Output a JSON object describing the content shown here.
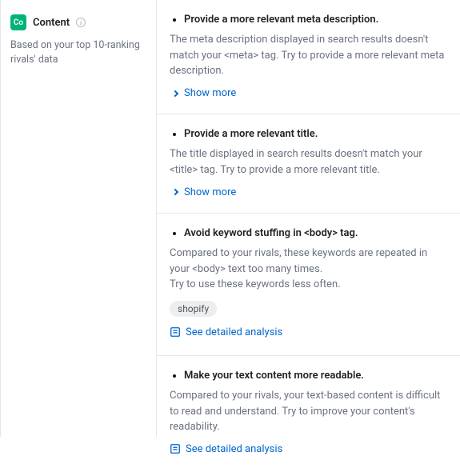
{
  "sidebar": {
    "badge": "Co",
    "title": "Content",
    "subtitle": "Based on your top 10-ranking rivals' data"
  },
  "labels": {
    "show_more": "Show more",
    "detailed_analysis": "See detailed analysis"
  },
  "items": [
    {
      "title": "Provide a more relevant meta description.",
      "desc": "The meta description displayed in search results doesn't match your <meta> tag. Try to provide a more relevant meta description.",
      "action": "show_more"
    },
    {
      "title": "Provide a more relevant title.",
      "desc": "The title displayed in search results doesn't match your <title> tag. Try to provide a more relevant title.",
      "action": "show_more"
    },
    {
      "title": "Avoid keyword stuffing in <body> tag.",
      "desc": "Compared to your rivals, these keywords are repeated in your <body> text too many times.\nTry to use these keywords less often.",
      "tag": "shopify",
      "action": "detailed"
    },
    {
      "title": "Make your text content more readable.",
      "desc": "Compared to your rivals, your text-based content is difficult to read and understand. Try to improve your content's readability.",
      "action": "detailed"
    }
  ]
}
